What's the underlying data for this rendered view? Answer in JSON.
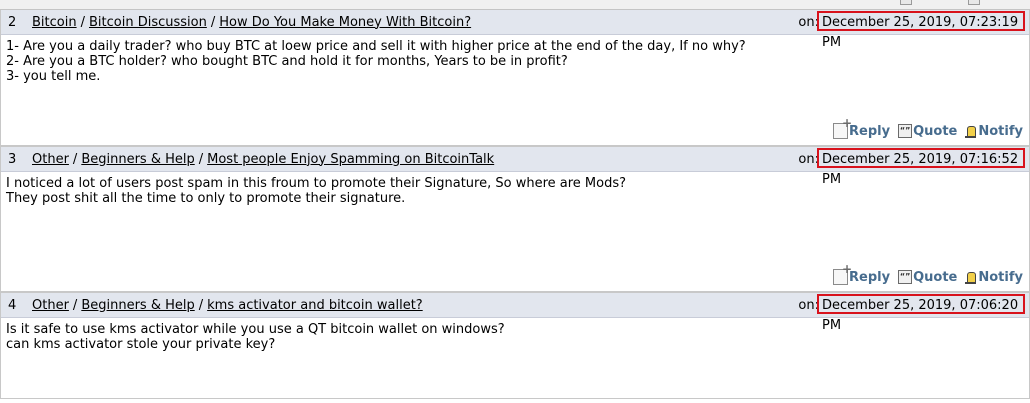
{
  "posts": [
    {
      "num": "2",
      "crumbs": [
        "Bitcoin",
        "Bitcoin Discussion",
        "How Do You Make Money With Bitcoin?"
      ],
      "on_label": "on:",
      "date": "December 25, 2019, 07:23:19 PM",
      "lines": [
        "1- Are you a daily trader? who buy BTC at loew price and sell it with higher price at the end of the day, If no why?",
        "2- Are you a BTC holder? who bought BTC and hold it for months, Years to be in profit?",
        "3- you tell me."
      ]
    },
    {
      "num": "3",
      "crumbs": [
        "Other",
        "Beginners & Help",
        "Most people Enjoy Spamming on BitcoinTalk"
      ],
      "on_label": "on:",
      "date": "December 25, 2019, 07:16:52 PM",
      "lines": [
        "I noticed a lot of users post spam in this froum to promote their Signature, So where are Mods?",
        "They post shit all the time to only to promote their signature."
      ]
    },
    {
      "num": "4",
      "crumbs": [
        "Other",
        "Beginners & Help",
        "kms activator and bitcoin wallet?"
      ],
      "on_label": "on:",
      "date": "December 25, 2019, 07:06:20 PM",
      "lines": [
        "Is it safe to use kms activator while you use a QT bitcoin wallet on windows?",
        "can kms activator stole your private key?"
      ]
    }
  ],
  "actions": {
    "reply": "Reply",
    "quote": "Quote",
    "notify": "Notify"
  },
  "colors": {
    "highlight": "#d8121c",
    "header_bg": "#e2e6ee",
    "action": "#476c8e"
  }
}
